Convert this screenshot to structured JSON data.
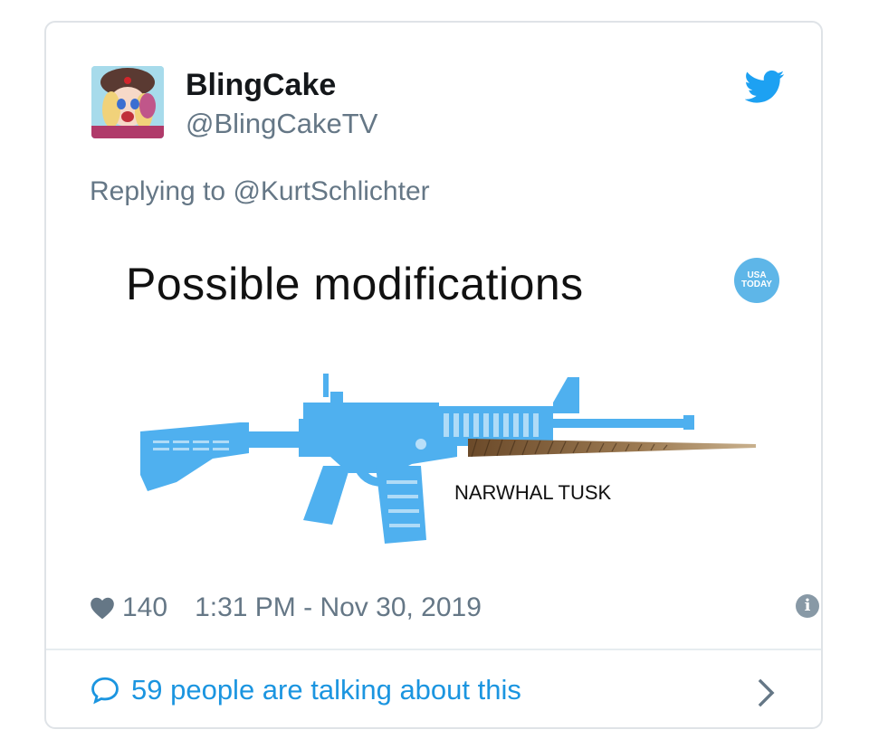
{
  "tweet": {
    "display_name": "BlingCake",
    "handle": "@BlingCakeTV",
    "reply_prefix": "Replying to",
    "reply_to": "@KurtSchlichter",
    "likes": "140",
    "timestamp": "1:31 PM - Nov 30, 2019",
    "talk_text": "59 people are talking about this"
  },
  "media": {
    "title": "Possible modifications",
    "badge_line1": "USA",
    "badge_line2": "TODAY",
    "tusk_label": "NARWHAL TUSK"
  },
  "icons": {
    "brand": "twitter-bird-icon",
    "like": "heart-icon",
    "info": "info-icon",
    "comment": "speech-bubble-icon",
    "chevron": "chevron-right-icon"
  },
  "colors": {
    "twitter_blue": "#1da1f2",
    "link_blue": "#1b95e0",
    "gun_blue": "#4fb0ef",
    "muted": "#657786"
  }
}
